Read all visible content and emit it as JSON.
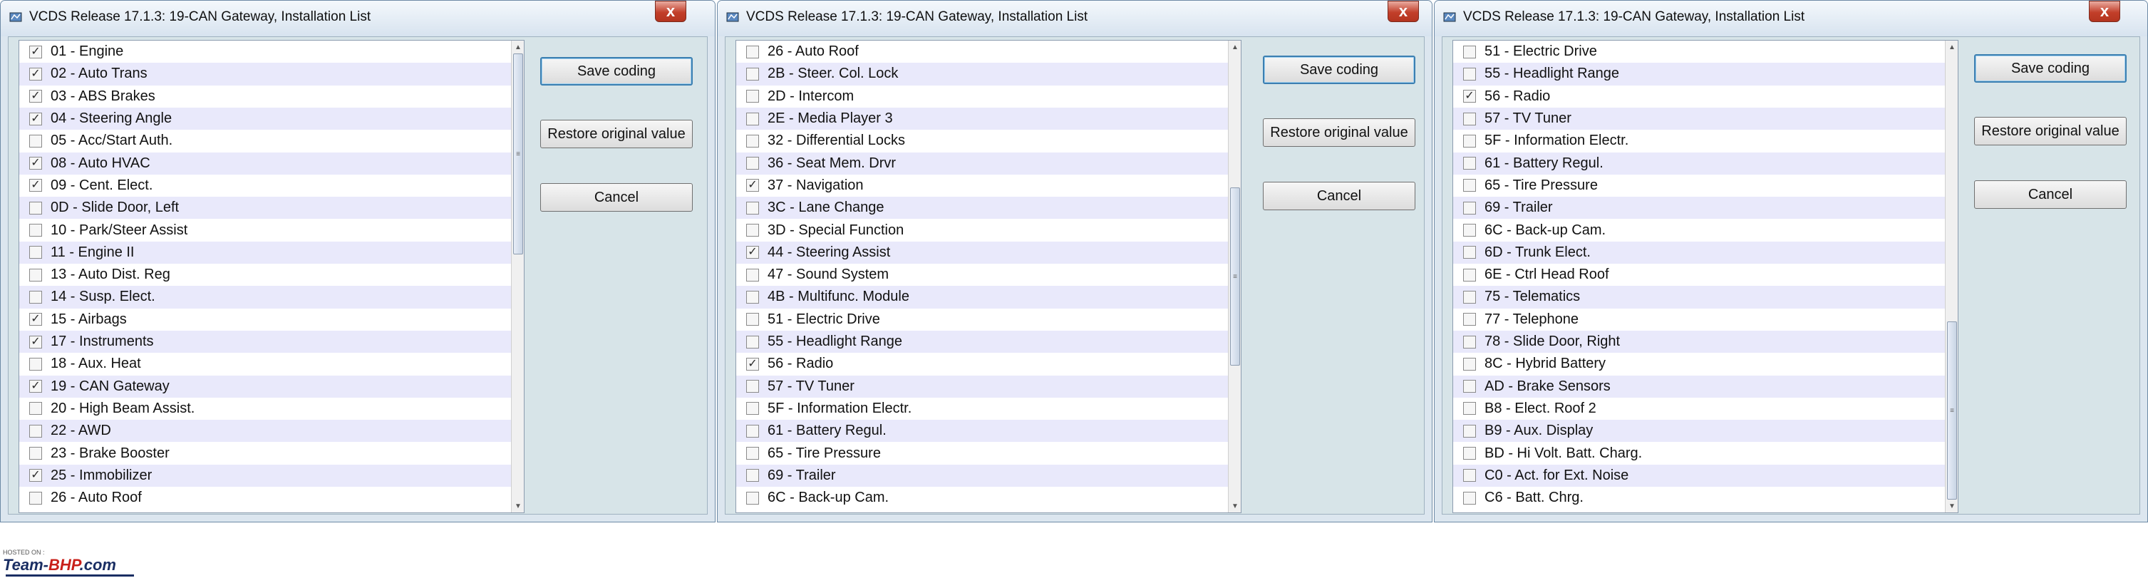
{
  "windows": [
    {
      "title": "VCDS Release 17.1.3: 19-CAN Gateway,  Installation List",
      "close_label": "x",
      "buttons": {
        "save": "Save coding",
        "restore": "Restore original value",
        "cancel": "Cancel"
      },
      "scroll": {
        "position": 0.0,
        "visible_fraction": 0.45
      },
      "items": [
        {
          "label": "01 - Engine",
          "checked": true
        },
        {
          "label": "02 - Auto Trans",
          "checked": true
        },
        {
          "label": "03 - ABS Brakes",
          "checked": true
        },
        {
          "label": "04 - Steering Angle",
          "checked": true
        },
        {
          "label": "05 - Acc/Start Auth.",
          "checked": false
        },
        {
          "label": "08 - Auto HVAC",
          "checked": true
        },
        {
          "label": "09 - Cent. Elect.",
          "checked": true
        },
        {
          "label": "0D - Slide Door, Left",
          "checked": false
        },
        {
          "label": "10 - Park/Steer Assist",
          "checked": false
        },
        {
          "label": "11 - Engine II",
          "checked": false
        },
        {
          "label": "13 - Auto Dist. Reg",
          "checked": false
        },
        {
          "label": "14 - Susp. Elect.",
          "checked": false
        },
        {
          "label": "15 - Airbags",
          "checked": true
        },
        {
          "label": "17 - Instruments",
          "checked": true
        },
        {
          "label": "18 - Aux. Heat",
          "checked": false
        },
        {
          "label": "19 - CAN Gateway",
          "checked": true
        },
        {
          "label": "20 - High Beam Assist.",
          "checked": false
        },
        {
          "label": "22 - AWD",
          "checked": false
        },
        {
          "label": "23 - Brake Booster",
          "checked": false
        },
        {
          "label": "25 - Immobilizer",
          "checked": true
        },
        {
          "label": "26 - Auto Roof",
          "checked": false
        }
      ]
    },
    {
      "title": "VCDS Release 17.1.3: 19-CAN Gateway,  Installation List",
      "close_label": "x",
      "buttons": {
        "save": "Save coding",
        "restore": "Restore original value",
        "cancel": "Cancel"
      },
      "scroll": {
        "position": 0.5,
        "visible_fraction": 0.4
      },
      "items": [
        {
          "label": "26 - Auto Roof",
          "checked": false
        },
        {
          "label": "2B - Steer. Col. Lock",
          "checked": false
        },
        {
          "label": "2D - Intercom",
          "checked": false
        },
        {
          "label": "2E - Media Player 3",
          "checked": false
        },
        {
          "label": "32 - Differential Locks",
          "checked": false
        },
        {
          "label": "36 - Seat Mem. Drvr",
          "checked": false
        },
        {
          "label": "37 - Navigation",
          "checked": true
        },
        {
          "label": "3C - Lane Change",
          "checked": false
        },
        {
          "label": "3D - Special Function",
          "checked": false
        },
        {
          "label": "44 - Steering Assist",
          "checked": true
        },
        {
          "label": "47 - Sound System",
          "checked": false
        },
        {
          "label": "4B - Multifunc. Module",
          "checked": false
        },
        {
          "label": "51 - Electric Drive",
          "checked": false
        },
        {
          "label": "55 - Headlight Range",
          "checked": false
        },
        {
          "label": "56 - Radio",
          "checked": true
        },
        {
          "label": "57 - TV Tuner",
          "checked": false
        },
        {
          "label": "5F - Information Electr.",
          "checked": false
        },
        {
          "label": "61 - Battery Regul.",
          "checked": false
        },
        {
          "label": "65 - Tire Pressure",
          "checked": false
        },
        {
          "label": "69 - Trailer",
          "checked": false
        },
        {
          "label": "6C - Back-up Cam.",
          "checked": false
        }
      ]
    },
    {
      "title": "VCDS Release 17.1.3: 19-CAN Gateway,  Installation List",
      "close_label": "x",
      "buttons": {
        "save": "Save coding",
        "restore": "Restore original value",
        "cancel": "Cancel"
      },
      "scroll": {
        "position": 1.0,
        "visible_fraction": 0.4
      },
      "items": [
        {
          "label": "51 - Electric Drive",
          "checked": false
        },
        {
          "label": "55 - Headlight Range",
          "checked": false
        },
        {
          "label": "56 - Radio",
          "checked": true
        },
        {
          "label": "57 - TV Tuner",
          "checked": false
        },
        {
          "label": "5F - Information Electr.",
          "checked": false
        },
        {
          "label": "61 - Battery Regul.",
          "checked": false
        },
        {
          "label": "65 - Tire Pressure",
          "checked": false
        },
        {
          "label": "69 - Trailer",
          "checked": false
        },
        {
          "label": "6C - Back-up Cam.",
          "checked": false
        },
        {
          "label": "6D - Trunk Elect.",
          "checked": false
        },
        {
          "label": "6E - Ctrl Head Roof",
          "checked": false
        },
        {
          "label": "75 - Telematics",
          "checked": false
        },
        {
          "label": "77 - Telephone",
          "checked": false
        },
        {
          "label": "78 - Slide Door, Right",
          "checked": false
        },
        {
          "label": "8C - Hybrid Battery",
          "checked": false
        },
        {
          "label": "AD - Brake Sensors",
          "checked": false
        },
        {
          "label": "B8 - Elect. Roof 2",
          "checked": false
        },
        {
          "label": "B9 - Aux. Display",
          "checked": false
        },
        {
          "label": "BD - Hi Volt. Batt. Charg.",
          "checked": false
        },
        {
          "label": "C0 - Act. for Ext. Noise",
          "checked": false
        },
        {
          "label": "C6 - Batt. Chrg.",
          "checked": false
        }
      ]
    }
  ],
  "watermark": {
    "hosted_on": "HOSTED ON :",
    "brand_part1": "Team-",
    "brand_part2": "BHP",
    "brand_part3": ".com"
  },
  "colors": {
    "window_bg": "#dce6ef",
    "list_alt_row": "#e9e9fb",
    "close_button": "#c23f2a",
    "default_button_border": "#3c7fb1"
  },
  "icons": {
    "check": "✓",
    "scroll_up": "▲",
    "scroll_down": "▼",
    "grip": "≡"
  }
}
